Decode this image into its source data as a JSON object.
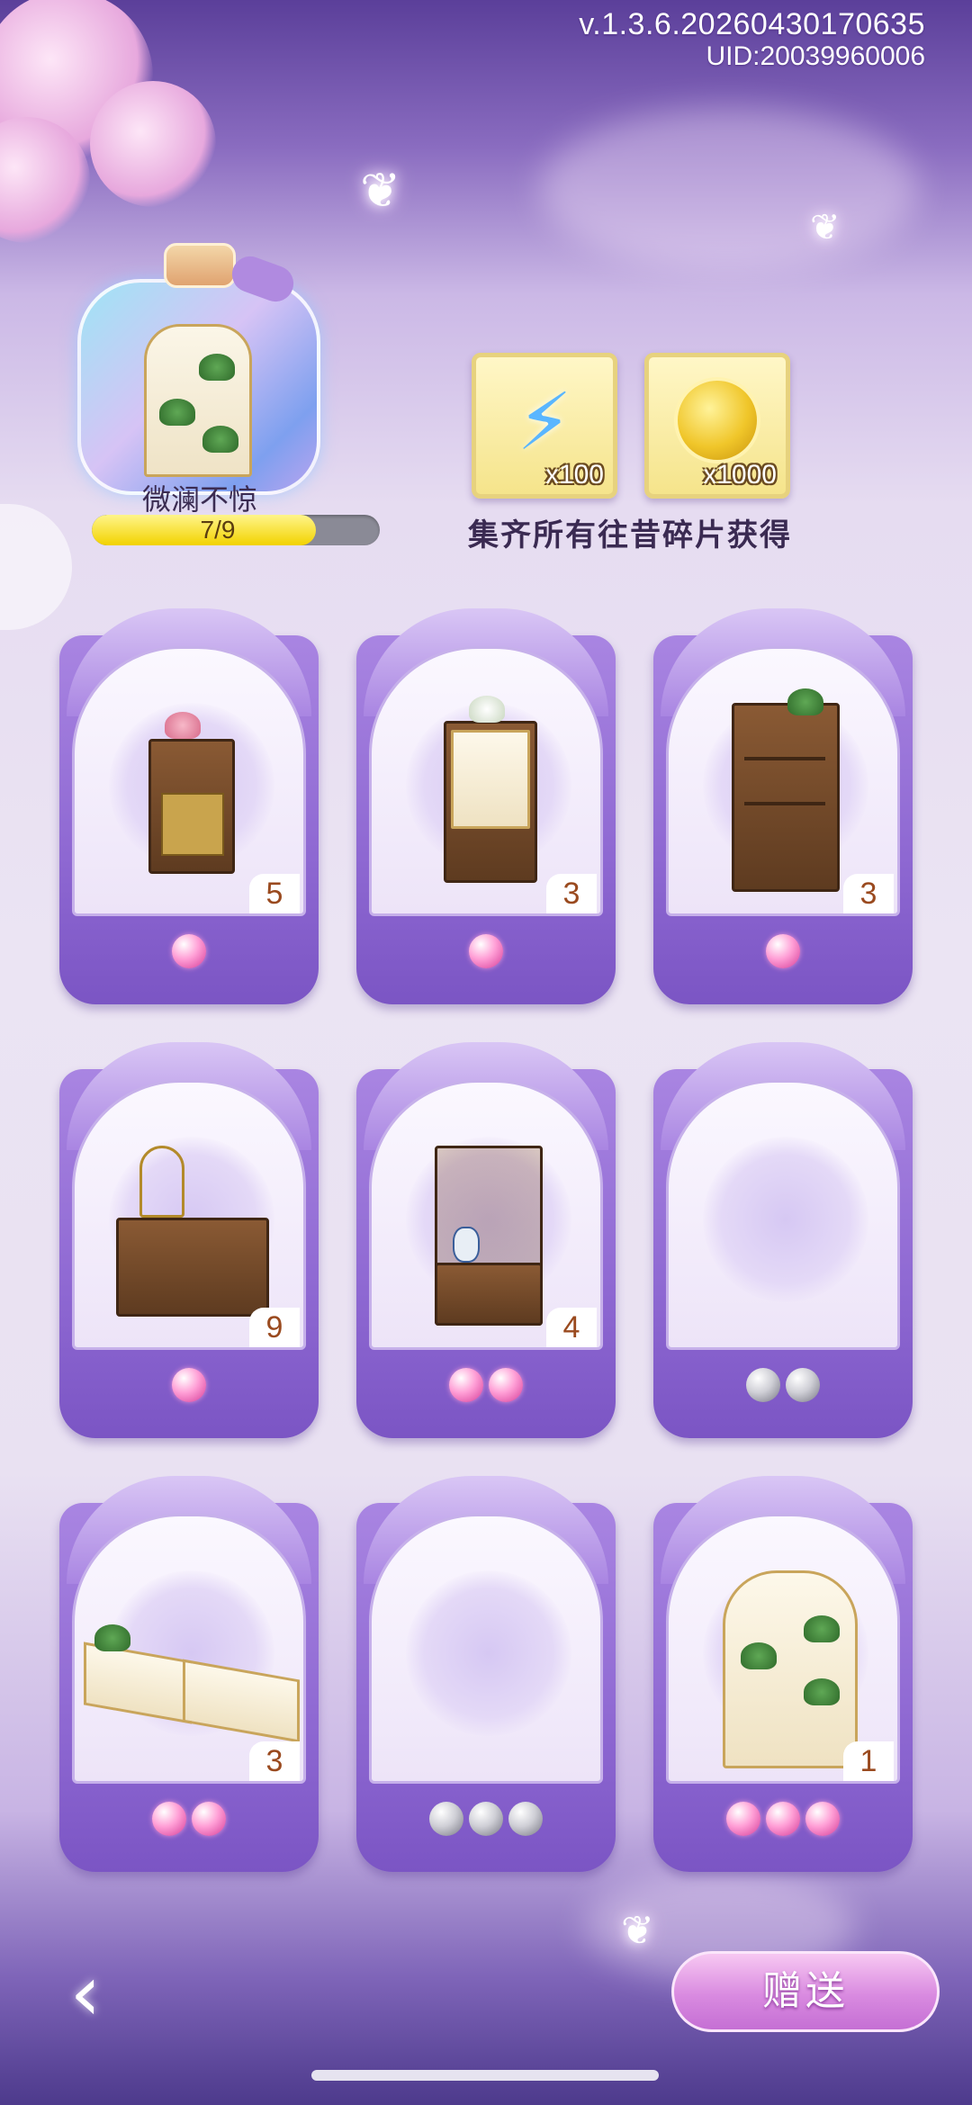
{
  "header": {
    "version": "v.1.3.6.20260430170635",
    "uid": "UID:20039960006"
  },
  "collection": {
    "name": "微澜不惊",
    "progress_text": "7/9",
    "progress_fraction": 0.778
  },
  "rewards": {
    "items": [
      {
        "icon": "lightning-bolt-icon",
        "count": "x100"
      },
      {
        "icon": "gold-clover-coin-icon",
        "count": "x1000"
      }
    ],
    "caption": "集齐所有往昔碎片获得"
  },
  "cards": [
    {
      "count": "5",
      "orbs": [
        "pink"
      ],
      "collected": true
    },
    {
      "count": "3",
      "orbs": [
        "pink"
      ],
      "collected": true
    },
    {
      "count": "3",
      "orbs": [
        "pink"
      ],
      "collected": true
    },
    {
      "count": "9",
      "orbs": [
        "pink"
      ],
      "collected": true
    },
    {
      "count": "4",
      "orbs": [
        "pink",
        "pink"
      ],
      "collected": true
    },
    {
      "count": "",
      "orbs": [
        "gray",
        "gray"
      ],
      "collected": false
    },
    {
      "count": "3",
      "orbs": [
        "pink",
        "pink"
      ],
      "collected": true
    },
    {
      "count": "",
      "orbs": [
        "gray",
        "gray",
        "gray"
      ],
      "collected": false
    },
    {
      "count": "1",
      "orbs": [
        "pink",
        "pink",
        "pink"
      ],
      "collected": true
    }
  ],
  "footer": {
    "back_glyph": "‹",
    "gift_label": "赠送"
  },
  "colors": {
    "card_purple": "#8e68d2",
    "orb_pink": "#ff9fd6",
    "orb_gray": "#cfcfd6",
    "progress_yellow": "#f2d200",
    "gift_button": "#d98ae0"
  }
}
